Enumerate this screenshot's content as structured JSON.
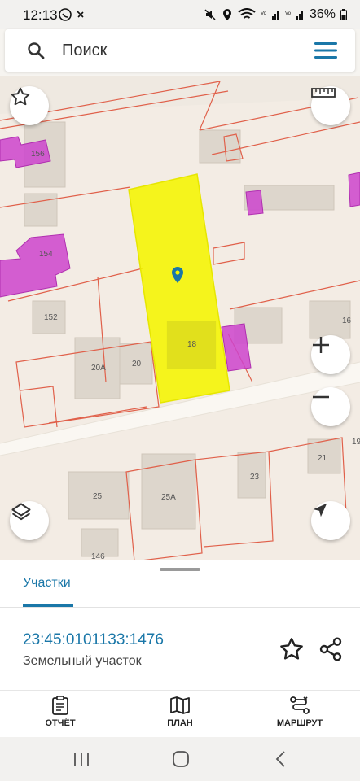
{
  "status_bar": {
    "time": "12:13",
    "battery": "36%",
    "sim1": "VoLTE1",
    "sim2": "VoLTE2"
  },
  "search": {
    "placeholder": "Поиск"
  },
  "map": {
    "lot_labels": [
      "156",
      "154",
      "152",
      "20А",
      "20",
      "18",
      "16",
      "19",
      "21",
      "23",
      "25",
      "25А",
      "146"
    ],
    "parcel_color": "#f5f500",
    "building_highlight_color": "#cc44cc",
    "boundary_color": "#e0604a"
  },
  "sheet": {
    "tab_label": "Участки",
    "cadastral_number": "23:45:0101133:1476",
    "parcel_type": "Земельный участок"
  },
  "actions": [
    {
      "label": "ОТЧЁТ",
      "icon": "clipboard-icon"
    },
    {
      "label": "ПЛАН",
      "icon": "map-icon"
    },
    {
      "label": "МАРШРУТ",
      "icon": "route-icon"
    }
  ],
  "colors": {
    "accent": "#1a77a8"
  }
}
